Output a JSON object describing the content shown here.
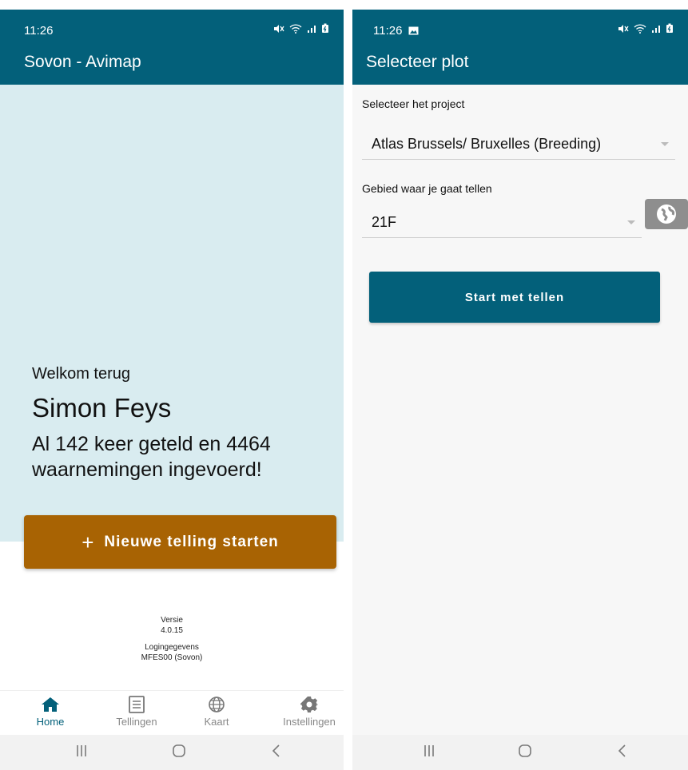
{
  "left": {
    "status": {
      "time": "11:26"
    },
    "appbar": {
      "title": "Sovon - Avimap"
    },
    "welcome": {
      "greeting": "Welkom terug",
      "user_name": "Simon Feys",
      "stats": "Al 142 keer geteld en 4464 waarnemingen ingevoerd!"
    },
    "cta": {
      "plus": "+",
      "label": "Nieuwe telling starten"
    },
    "version": {
      "label": "Versie",
      "value": "4.0.15",
      "login_label": "Logingegevens",
      "login_value": "MFES00 (Sovon)"
    },
    "bottom_nav": [
      {
        "label": "Home",
        "icon": "home-icon",
        "active": true
      },
      {
        "label": "Tellingen",
        "icon": "list-icon",
        "active": false
      },
      {
        "label": "Kaart",
        "icon": "globe-icon",
        "active": false
      },
      {
        "label": "Instellingen",
        "icon": "gear-icon",
        "active": false
      }
    ]
  },
  "right": {
    "status": {
      "time": "11:26"
    },
    "appbar": {
      "title": "Selecteer plot"
    },
    "project": {
      "label": "Selecteer het project",
      "value": "Atlas Brussels/ Bruxelles (Breeding)"
    },
    "area": {
      "label": "Gebied waar je gaat tellen",
      "value": "21F"
    },
    "start_button": {
      "label": "Start met tellen"
    }
  },
  "colors": {
    "primary": "#03607a",
    "accent": "#a86303",
    "welcome_bg": "#d9ecf0",
    "nav_inactive": "#888888"
  }
}
